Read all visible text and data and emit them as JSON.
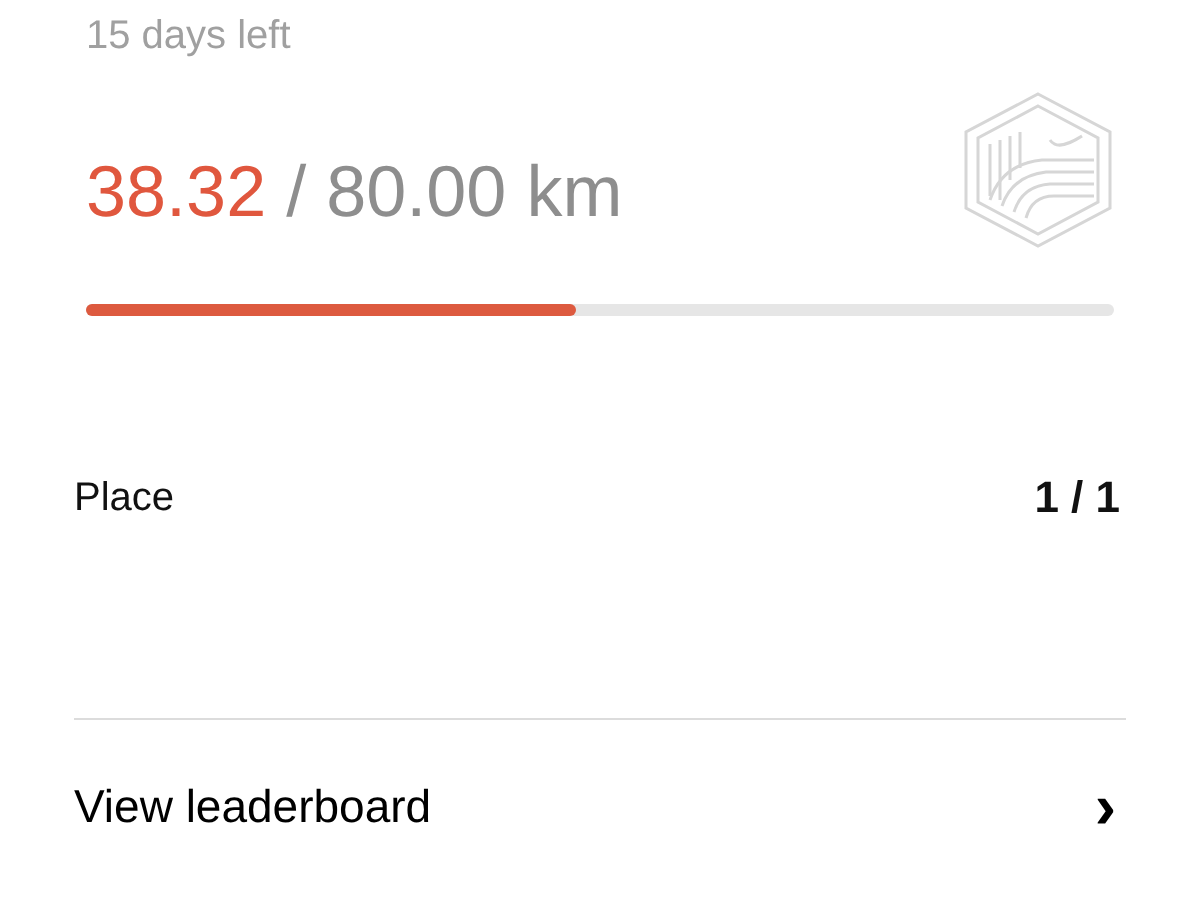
{
  "challenge": {
    "days_left": "15 days left",
    "progress_value": "38.32",
    "progress_goal": "/ 80.00 km",
    "level": 0.477
  },
  "place": {
    "label": "Place",
    "value": "1 / 1"
  },
  "link": {
    "label": "View leaderboard",
    "chevron": "›"
  }
}
